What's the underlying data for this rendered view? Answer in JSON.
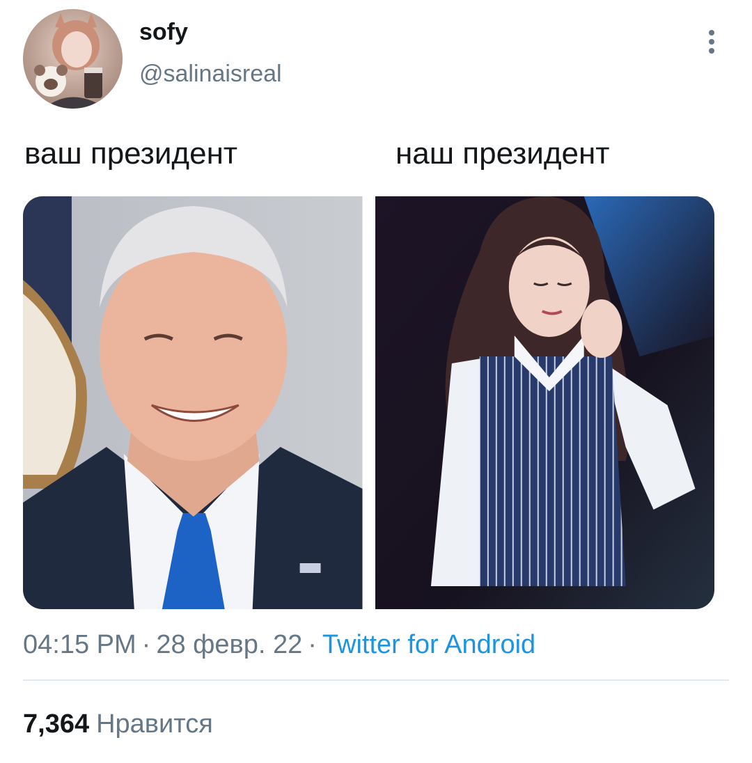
{
  "user": {
    "display_name": "sofy",
    "handle": "@salinaisreal",
    "avatar_icon": "avatar-image"
  },
  "tweet": {
    "text_left": "ваш президент",
    "text_right": "наш президент"
  },
  "media": {
    "photos": [
      {
        "subject": "photo-left"
      },
      {
        "subject": "photo-right"
      }
    ]
  },
  "meta": {
    "time": "04:15 PM",
    "separator": "·",
    "date": "28 февр. 22",
    "source": "Twitter for Android"
  },
  "engagement": {
    "likes_count": "7,364",
    "likes_label": "Нравится"
  },
  "colors": {
    "text_primary": "#14171a",
    "text_secondary": "#657786",
    "link": "#1b95e0",
    "divider": "#e1e8ed"
  },
  "icons": {
    "more": "more-vertical-icon"
  }
}
